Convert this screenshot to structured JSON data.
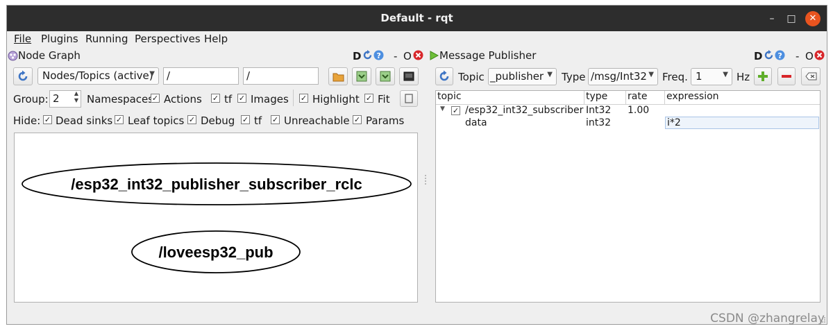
{
  "window": {
    "title": "Default - rqt",
    "minimize_glyph": "–",
    "maximize_glyph": "□",
    "close_glyph": "✕"
  },
  "menubar": [
    {
      "label": "File"
    },
    {
      "label": "Plugins"
    },
    {
      "label": "Running"
    },
    {
      "label": "Perspectives"
    },
    {
      "label": "Help"
    }
  ],
  "node_graph": {
    "title": "Node Graph",
    "header_buttons": {
      "dock": "D",
      "minus": "-",
      "float": "O"
    },
    "graph_type": "Nodes/Topics (active)",
    "filter_1": "/",
    "filter_2": "/",
    "group_label": "Group:",
    "group_value": "2",
    "options": [
      {
        "label": "Namespaces",
        "checked": false
      },
      {
        "label": "Actions",
        "checked": true
      },
      {
        "label": "tf",
        "checked": true
      },
      {
        "label": "Images",
        "checked": true
      },
      {
        "label": "Highlight",
        "checked": true
      },
      {
        "label": "Fit",
        "checked": true
      }
    ],
    "hide_label": "Hide:",
    "hide": [
      {
        "label": "Dead sinks",
        "checked": true
      },
      {
        "label": "Leaf topics",
        "checked": true
      },
      {
        "label": "Debug",
        "checked": true
      },
      {
        "label": "tf",
        "checked": true
      },
      {
        "label": "Unreachable",
        "checked": true
      },
      {
        "label": "Params",
        "checked": true
      }
    ],
    "nodes": [
      {
        "name": "/esp32_int32_publisher_subscriber_rclc"
      },
      {
        "name": "/loveesp32_pub"
      }
    ]
  },
  "message_publisher": {
    "title": "Message Publisher",
    "header_buttons": {
      "dock": "D",
      "minus": "-",
      "float": "O"
    },
    "topic_label": "Topic",
    "topic_value": "_publisher",
    "type_label": "Type",
    "type_value": "/msg/Int32",
    "freq_label": "Freq.",
    "freq_value": "1",
    "hz_label": "Hz",
    "columns": [
      "topic",
      "type",
      "rate",
      "expression"
    ],
    "rows": [
      {
        "topic": "/esp32_int32_subscriber",
        "type": "Int32",
        "rate": "1.00",
        "expression": "",
        "checked": true
      },
      {
        "topic": "data",
        "type": "int32",
        "rate": "",
        "expression": "i*2"
      }
    ]
  },
  "watermark": "CSDN @zhangrelay",
  "colors": {
    "titlebar": "#2d2d2d",
    "close": "#e9541f",
    "window_bg": "#efefef",
    "accent_blue": "#3d74c4"
  }
}
